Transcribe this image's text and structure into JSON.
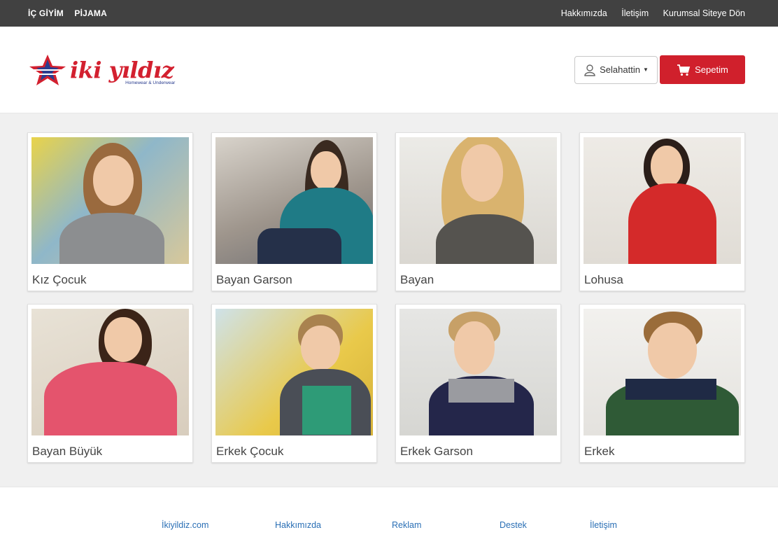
{
  "topbar": {
    "left": [
      "İÇ GİYİM",
      "PİJAMA"
    ],
    "right": [
      "Hakkımızda",
      "İletişim",
      "Kurumsal Siteye Dön"
    ]
  },
  "header": {
    "logo_text": "iki yıldız",
    "logo_sub": "Homewear & Underwear",
    "user_label": "Selahattin",
    "cart_label": "Sepetim"
  },
  "categories": [
    {
      "label": "Kız Çocuk"
    },
    {
      "label": "Bayan Garson"
    },
    {
      "label": "Bayan"
    },
    {
      "label": "Lohusa"
    },
    {
      "label": "Bayan Büyük"
    },
    {
      "label": "Erkek Çocuk"
    },
    {
      "label": "Erkek Garson"
    },
    {
      "label": "Erkek"
    }
  ],
  "footer": {
    "links": [
      "İkiyildiz.com",
      "Hakkımızda",
      "Reklam",
      "Destek",
      "İletişim"
    ]
  },
  "colors": {
    "topbar_bg": "#414141",
    "brand_red": "#d0202c",
    "brand_blue": "#2a3d8f",
    "footer_link": "#2a6fb5"
  }
}
